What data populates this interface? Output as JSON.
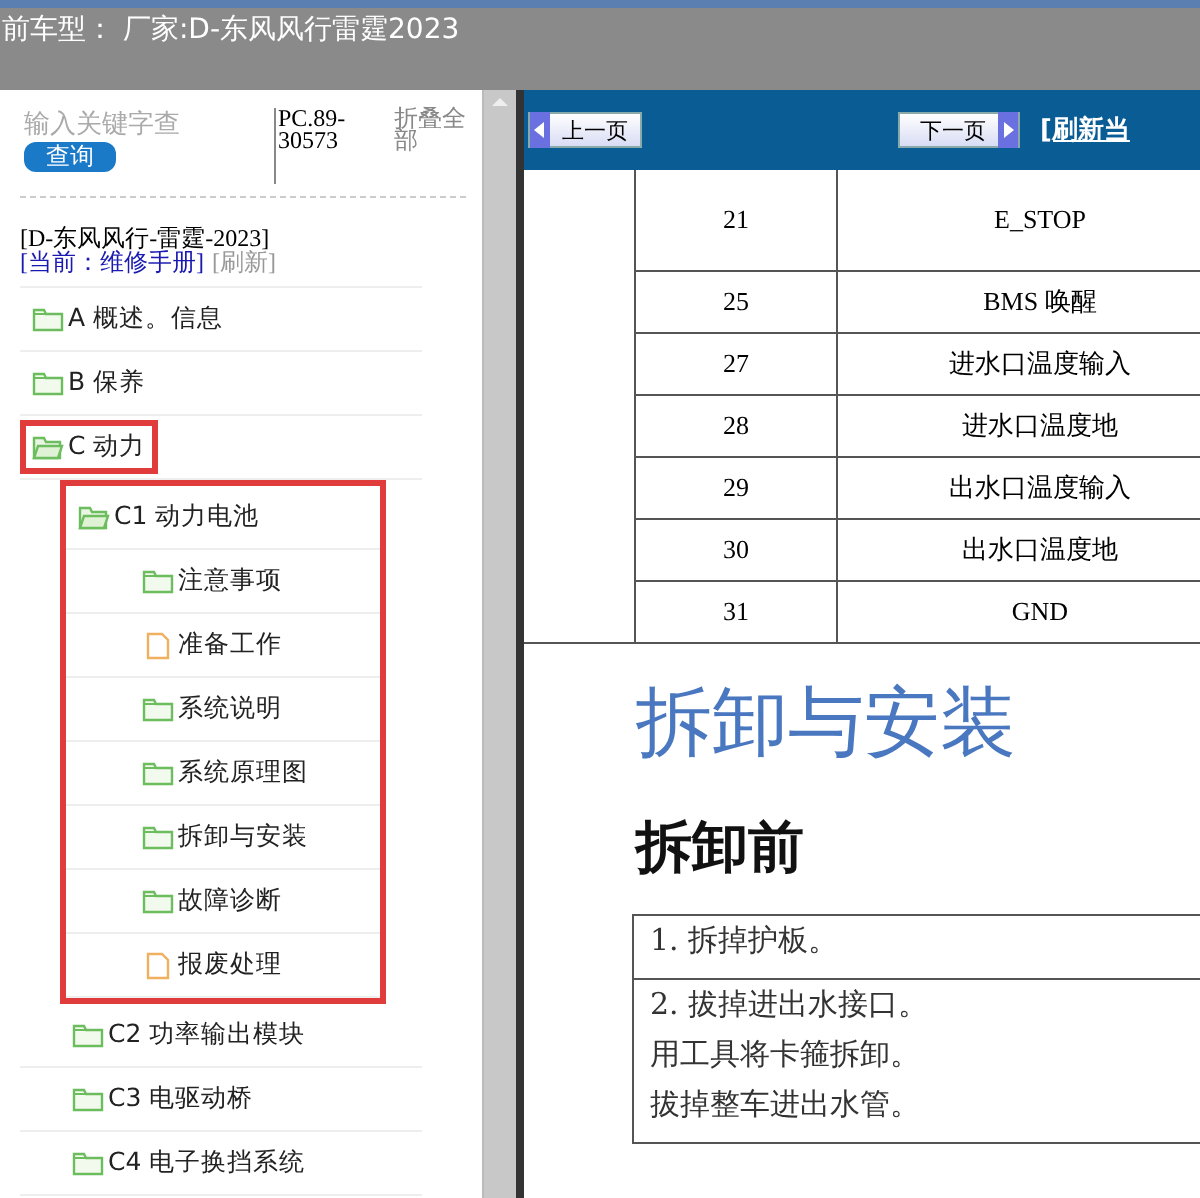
{
  "title_bar": {
    "text": "前车型：  厂家:D-东风风行雷霆2023"
  },
  "sidebar": {
    "search": {
      "placeholder": "输入关键字查"
    },
    "search_button": "查询",
    "code": "PC.89-30573",
    "collapse_all": "折叠全部",
    "model": "[D-东风风行-雷霆-2023]",
    "current": "[当前：维修手册]",
    "refresh": "[刷新]",
    "tree": [
      {
        "label": "A 概述。信息",
        "kind": "folder",
        "expanded": false,
        "highlighted": false
      },
      {
        "label": "B 保养",
        "kind": "folder",
        "expanded": false,
        "highlighted": false
      },
      {
        "label": "C 动力",
        "kind": "folder",
        "expanded": true,
        "highlighted": true,
        "children": [
          {
            "label": "C1 动力电池",
            "kind": "folder",
            "expanded": true,
            "highlighted": true,
            "children": [
              {
                "label": "注意事项",
                "kind": "folder",
                "expanded": false,
                "highlighted": false
              },
              {
                "label": "准备工作",
                "kind": "document",
                "expanded": false,
                "highlighted": false
              },
              {
                "label": "系统说明",
                "kind": "folder",
                "expanded": false,
                "highlighted": false
              },
              {
                "label": "系统原理图",
                "kind": "folder",
                "expanded": false,
                "highlighted": false
              },
              {
                "label": "拆卸与安装",
                "kind": "folder",
                "expanded": false,
                "highlighted": false
              },
              {
                "label": "故障诊断",
                "kind": "folder",
                "expanded": false,
                "highlighted": false
              },
              {
                "label": "报废处理",
                "kind": "document",
                "expanded": false,
                "highlighted": false
              }
            ]
          },
          {
            "label": "C2 功率输出模块",
            "kind": "folder",
            "expanded": false,
            "highlighted": false
          },
          {
            "label": "C3 电驱动桥",
            "kind": "folder",
            "expanded": false,
            "highlighted": false
          },
          {
            "label": "C4 电子换挡系统",
            "kind": "folder",
            "expanded": false,
            "highlighted": false
          }
        ]
      }
    ]
  },
  "document": {
    "prev_button": "上一页",
    "next_button": "下一页",
    "refresh_link": "[刷新当",
    "pin_table": [
      {
        "pin": "21",
        "signal": "E_STOP"
      },
      {
        "pin": "25",
        "signal": "BMS 唤醒"
      },
      {
        "pin": "27",
        "signal": "进水口温度输入"
      },
      {
        "pin": "28",
        "signal": "进水口温度地"
      },
      {
        "pin": "29",
        "signal": "出水口温度输入"
      },
      {
        "pin": "30",
        "signal": "出水口温度地"
      },
      {
        "pin": "31",
        "signal": "GND"
      }
    ],
    "heading": "拆卸与安装",
    "subheading": "拆卸前",
    "steps": [
      {
        "lines": [
          "1. 拆掉护板。"
        ]
      },
      {
        "lines": [
          "2. 拔掉进出水接口。",
          "用工具将卡箍拆卸。",
          "拔掉整车进出水管。"
        ]
      }
    ]
  }
}
